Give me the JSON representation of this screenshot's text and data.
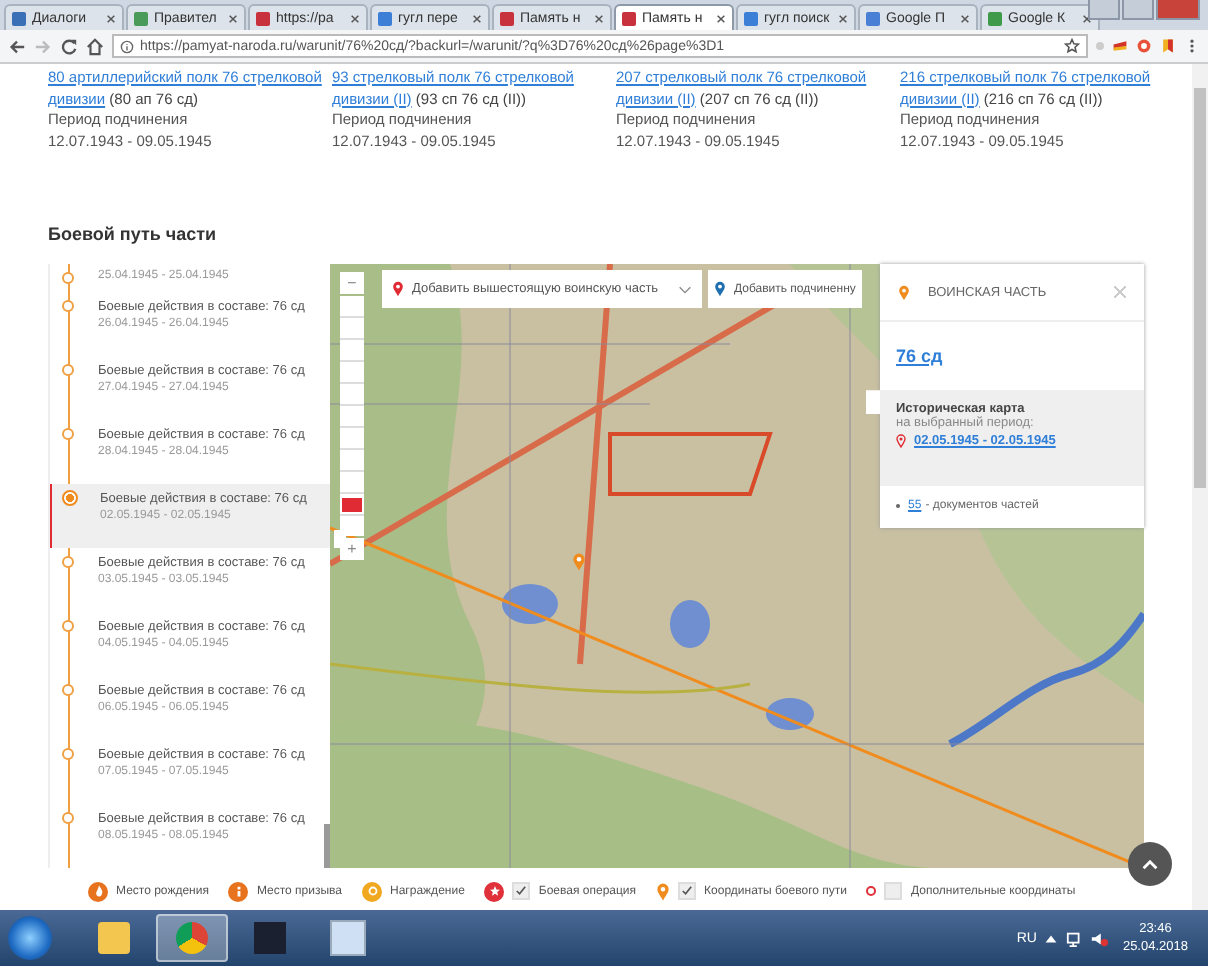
{
  "browser": {
    "tabs": [
      {
        "label": "Диалоги",
        "selected": false,
        "color": "#3b6fb6"
      },
      {
        "label": "Правител",
        "selected": false,
        "color": "#4a9a5a"
      },
      {
        "label": "https://pa",
        "selected": false,
        "color": "#c8323c"
      },
      {
        "label": "гугл пере",
        "selected": false,
        "color": "#3b7fd6"
      },
      {
        "label": "Память н",
        "selected": false,
        "color": "#c8323c"
      },
      {
        "label": "Память н",
        "selected": true,
        "color": "#c8323c"
      },
      {
        "label": "гугл поиск",
        "selected": false,
        "color": "#3b7fd6"
      },
      {
        "label": "Google П",
        "selected": false,
        "color": "#4a7fd6"
      },
      {
        "label": "Google К",
        "selected": false,
        "color": "#3f9a4a"
      }
    ],
    "url": "https://pamyat-naroda.ru/warunit/76%20сд/?backurl=/warunit/?q%3D76%20сд%26page%3D1"
  },
  "units": [
    {
      "link": "80 артиллерийский полк 76 стрелковой дивизии",
      "abbr": "(80 ап 76 сд)",
      "period_label": "Период подчинения",
      "period": "12.07.1943 - 09.05.1945"
    },
    {
      "link": "93 стрелковый полк 76 стрелковой дивизии (II)",
      "abbr": "(93 сп 76 сд (II))",
      "period_label": "Период подчинения",
      "period": "12.07.1943 - 09.05.1945"
    },
    {
      "link": "207 стрелковый полк 76 стрелковой дивизии (II)",
      "abbr": "(207 сп 76 сд (II))",
      "period_label": "Период подчинения",
      "period": "12.07.1943 - 09.05.1945"
    },
    {
      "link": "216 стрелковый полк 76 стрелковой дивизии (II)",
      "abbr": "(216 сп 76 сд (II))",
      "period_label": "Период подчинения",
      "period": "12.07.1943 - 09.05.1945"
    }
  ],
  "section_title": "Боевой путь части",
  "timeline": [
    {
      "date": "25.04.1945 - 25.04.1945",
      "selected": false
    },
    {
      "title": "Боевые действия в составе: 76 сд",
      "date": "26.04.1945 - 26.04.1945",
      "selected": false
    },
    {
      "title": "Боевые действия в составе: 76 сд",
      "date": "27.04.1945 - 27.04.1945",
      "selected": false
    },
    {
      "title": "Боевые действия в составе: 76 сд",
      "date": "28.04.1945 - 28.04.1945",
      "selected": false
    },
    {
      "title": "Боевые действия в составе: 76 сд",
      "date": "02.05.1945 - 02.05.1945",
      "selected": true
    },
    {
      "title": "Боевые действия в составе: 76 сд",
      "date": "03.05.1945 - 03.05.1945",
      "selected": false
    },
    {
      "title": "Боевые действия в составе: 76 сд",
      "date": "04.05.1945 - 04.05.1945",
      "selected": false
    },
    {
      "title": "Боевые действия в составе: 76 сд",
      "date": "06.05.1945 - 06.05.1945",
      "selected": false
    },
    {
      "title": "Боевые действия в составе: 76 сд",
      "date": "07.05.1945 - 07.05.1945",
      "selected": false
    },
    {
      "title": "Боевые действия в составе: 76 сд",
      "date": "08.05.1945 - 08.05.1945",
      "selected": false
    }
  ],
  "map": {
    "filters": [
      {
        "label": "Добавить вышестоящую воинскую часть",
        "color": "#e02b35"
      },
      {
        "label": "Добавить подчиненну",
        "color": "#1f6fb0"
      }
    ],
    "zoom_out": "−",
    "zoom_in": "+",
    "zoom": {
      "level": 0.1
    },
    "popup": {
      "heading": "ВОИНСКАЯ ЧАСТЬ",
      "unit": "76 сд",
      "map_title": "Историческая карта",
      "map_sub": "на выбранный период:",
      "period": "02.05.1945 - 02.05.1945",
      "docs_count": "55",
      "docs_label": "- документов частей"
    }
  },
  "legend": [
    {
      "kind": "flame",
      "label": "Место рождения",
      "color": "#e8731f"
    },
    {
      "kind": "person",
      "label": "Место призыва",
      "color": "#e8731f"
    },
    {
      "kind": "medal",
      "label": "Награждение",
      "color": "#f0a820"
    },
    {
      "kind": "star",
      "label": "Боевая операция",
      "color": "#e0303a",
      "checked": true
    },
    {
      "kind": "pin",
      "label": "Координаты боевого пути",
      "color": "#f08c1e",
      "checked": true
    },
    {
      "kind": "dot",
      "label": "Дополнительные координаты",
      "color": "#e0303a",
      "checked": false
    }
  ],
  "taskbar": {
    "apps": [
      {
        "kind": "folder",
        "selected": false
      },
      {
        "kind": "chrome",
        "selected": true
      },
      {
        "kind": "dark",
        "selected": false
      },
      {
        "kind": "doc",
        "selected": false
      }
    ],
    "language": "RU",
    "time": "23:46",
    "date": "25.04.2018"
  }
}
